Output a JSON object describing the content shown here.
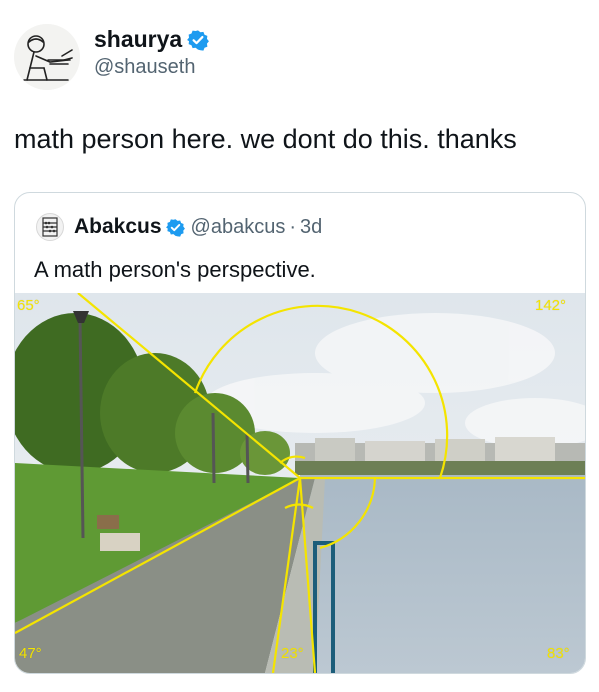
{
  "tweet": {
    "author_name": "shaurya",
    "author_handle": "@shauseth",
    "text": "math person here. we dont do this. thanks"
  },
  "quoted": {
    "author_name": "Abakcus",
    "author_handle": "@abakcus",
    "separator": "·",
    "age": "3d",
    "text": "A math person's perspective.",
    "angles": {
      "top_left": "65°",
      "top_right": "142°",
      "bottom_left": "47°",
      "bottom_middle": "23°",
      "bottom_right": "83°"
    }
  },
  "colors": {
    "verified": "#1d9bf0",
    "overlay": "#f4e400",
    "secondary_text": "#536471"
  },
  "icons": {
    "avatar": "sketch-person-at-desk",
    "verified": "verified-badge-icon",
    "quoted_avatar": "abacus-icon"
  }
}
